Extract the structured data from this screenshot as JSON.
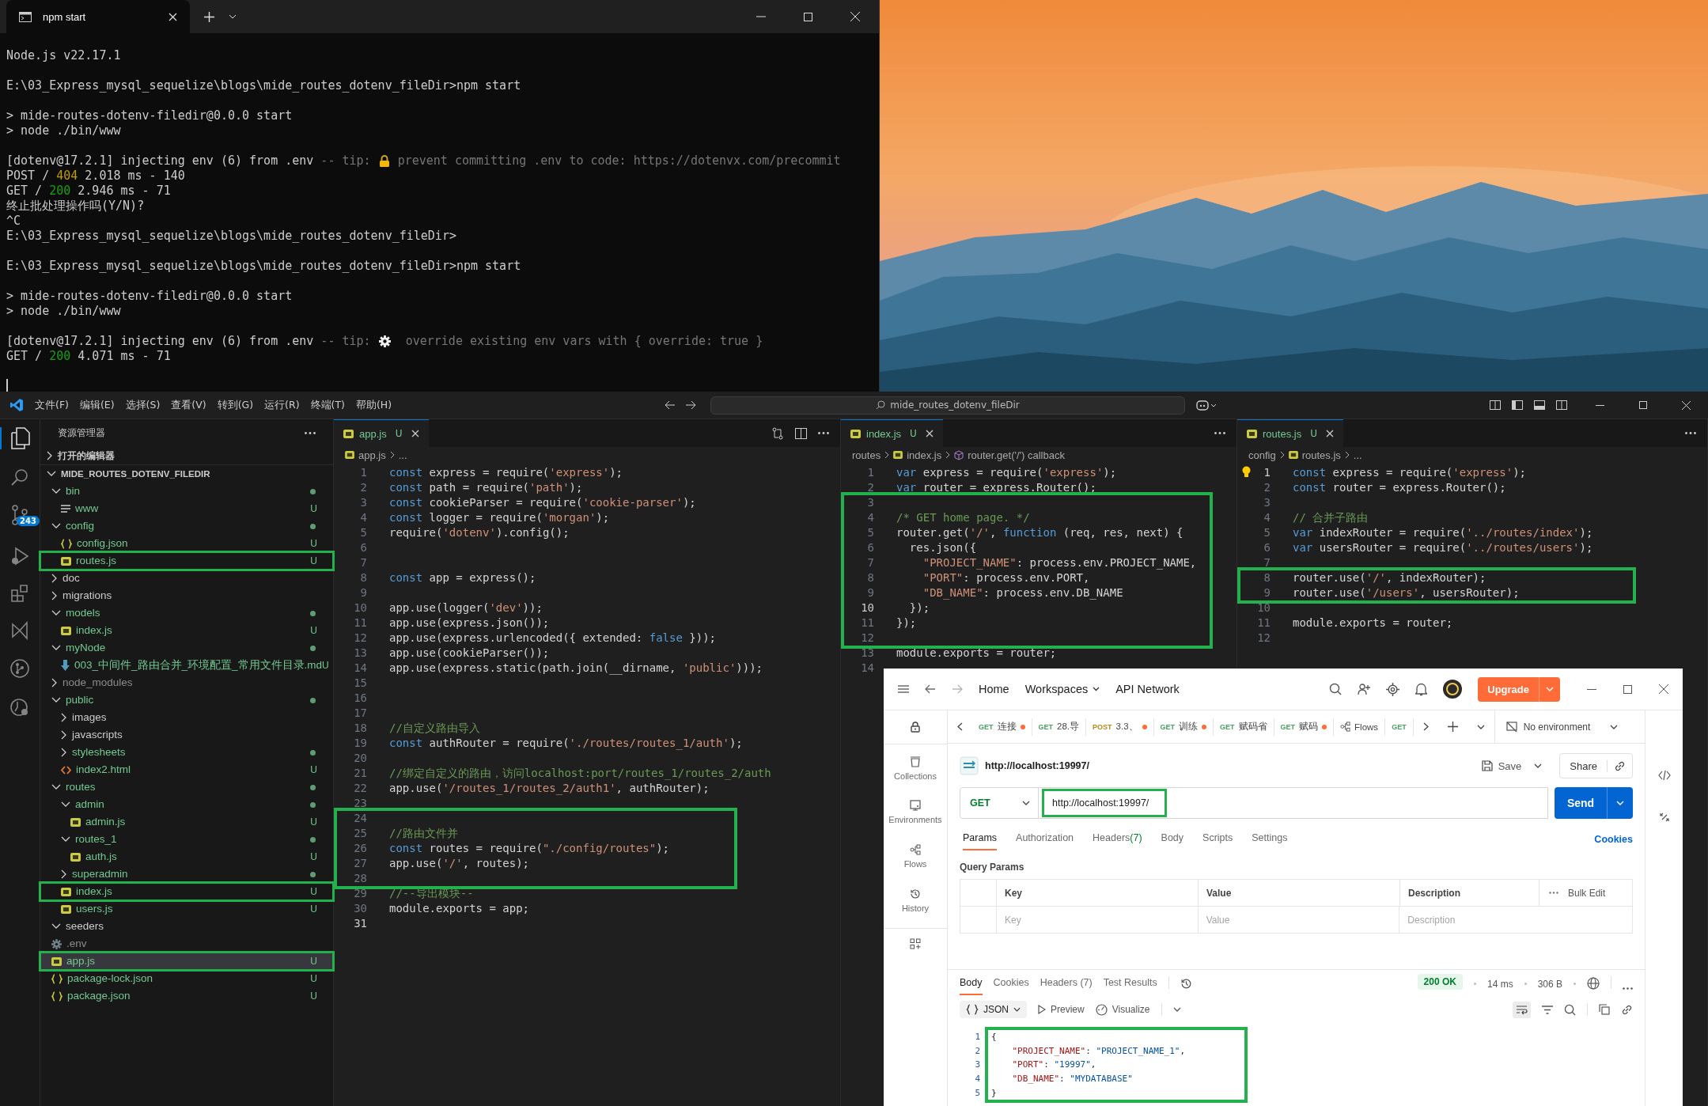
{
  "terminal": {
    "tab": "npm start",
    "blocks": [
      {
        "lines": [
          {
            "segments": [
              {
                "text": "Node.js v22.17.1",
                "kind": "txt"
              }
            ]
          }
        ]
      },
      {
        "lines": [
          {
            "segments": [
              {
                "text": "E:\\03_Express_mysql_sequelize\\blogs\\mide_routes_dotenv_fileDir>npm start",
                "kind": "txt"
              }
            ]
          }
        ]
      },
      {
        "lines": [
          {
            "segments": [
              {
                "text": "> mide-routes-dotenv-filedir@0.0.0 start",
                "kind": "txt"
              }
            ]
          },
          {
            "segments": [
              {
                "text": "> node ./bin/www",
                "kind": "txt"
              }
            ]
          }
        ]
      },
      {
        "lines": [
          {
            "segments": [
              {
                "text": "[dotenv@17.2.1] injecting env (6) from .env",
                "kind": "txt"
              },
              {
                "text": " -- tip: ",
                "kind": "dim"
              },
              {
                "kind": "lock"
              },
              {
                "text": " prevent committing .env to code: https://dotenvx.com/precommit",
                "kind": "dim"
              }
            ]
          },
          {
            "segments": [
              {
                "text": "POST / ",
                "kind": "txt"
              },
              {
                "text": "404",
                "kind": "warn"
              },
              {
                "text": " 2.018 ms - 140",
                "kind": "txt"
              }
            ]
          },
          {
            "segments": [
              {
                "text": "GET / ",
                "kind": "txt"
              },
              {
                "text": "200",
                "kind": "ok"
              },
              {
                "text": " 2.946 ms - 71",
                "kind": "txt"
              }
            ]
          },
          {
            "segments": [
              {
                "text": "终止批处理操作吗(Y/N)?",
                "kind": "txt"
              }
            ]
          },
          {
            "segments": [
              {
                "text": "^C",
                "kind": "txt"
              }
            ]
          },
          {
            "segments": [
              {
                "text": "E:\\03_Express_mysql_sequelize\\blogs\\mide_routes_dotenv_fileDir>",
                "kind": "txt"
              }
            ]
          }
        ]
      },
      {
        "lines": [
          {
            "segments": [
              {
                "text": "E:\\03_Express_mysql_sequelize\\blogs\\mide_routes_dotenv_fileDir>npm start",
                "kind": "txt"
              }
            ]
          }
        ]
      },
      {
        "lines": [
          {
            "segments": [
              {
                "text": "> mide-routes-dotenv-filedir@0.0.0 start",
                "kind": "txt"
              }
            ]
          },
          {
            "segments": [
              {
                "text": "> node ./bin/www",
                "kind": "txt"
              }
            ]
          }
        ]
      },
      {
        "lines": [
          {
            "segments": [
              {
                "text": "[dotenv@17.2.1] injecting env (6) from .env",
                "kind": "txt"
              },
              {
                "text": " -- tip: ",
                "kind": "dim"
              },
              {
                "kind": "gear"
              },
              {
                "text": "  override existing env vars with { override: true }",
                "kind": "dim"
              }
            ]
          },
          {
            "segments": [
              {
                "text": "GET / ",
                "kind": "txt"
              },
              {
                "text": "200",
                "kind": "ok"
              },
              {
                "text": " 4.071 ms - 71",
                "kind": "txt"
              }
            ]
          }
        ]
      }
    ]
  },
  "vscode": {
    "menu": [
      "文件(F)",
      "编辑(E)",
      "选择(S)",
      "查看(V)",
      "转到(G)",
      "运行(R)",
      "终端(T)",
      "帮助(H)"
    ],
    "search": "mide_routes_dotenv_fileDir",
    "scm_badge": "243",
    "explorer": {
      "title": "资源管理器",
      "open_editors": "打开的编辑器",
      "root": "MIDE_ROUTES_DOTENV_FILEDIR",
      "items": [
        {
          "name": "bin",
          "kind": "folder",
          "expanded": true,
          "dot": true,
          "color": "#73c991",
          "selected": false,
          "boxed": false,
          "children": [
            {
              "name": "www",
              "kind": "text",
              "status": "U",
              "color": "#73c991",
              "selected": false,
              "boxed": false
            }
          ]
        },
        {
          "name": "config",
          "kind": "folder",
          "expanded": true,
          "dot": true,
          "color": "#73c991",
          "selected": false,
          "boxed": false,
          "children": [
            {
              "name": "config.json",
              "kind": "json",
              "status": "U",
              "color": "#73c991",
              "selected": false,
              "boxed": false
            },
            {
              "name": "routes.js",
              "kind": "js",
              "status": "U",
              "color": "#73c991",
              "selected": false,
              "boxed": true
            }
          ]
        },
        {
          "name": "doc",
          "kind": "folder",
          "expanded": false,
          "dot": false,
          "color": "#cccccc",
          "selected": false,
          "boxed": false
        },
        {
          "name": "migrations",
          "kind": "folder",
          "expanded": false,
          "dot": false,
          "color": "#cccccc",
          "selected": false,
          "boxed": false
        },
        {
          "name": "models",
          "kind": "folder",
          "expanded": true,
          "dot": true,
          "color": "#73c991",
          "selected": false,
          "boxed": false,
          "children": [
            {
              "name": "index.js",
              "kind": "js",
              "status": "U",
              "color": "#73c991",
              "selected": false,
              "boxed": false
            }
          ]
        },
        {
          "name": "myNode",
          "kind": "folder",
          "expanded": true,
          "dot": true,
          "color": "#73c991",
          "selected": false,
          "boxed": false,
          "children": [
            {
              "name": "003_中间件_路由合并_环境配置_常用文件目录.md",
              "kind": "md",
              "status": "U",
              "color": "#73c991",
              "selected": false,
              "boxed": false
            }
          ]
        },
        {
          "name": "node_modules",
          "kind": "folder",
          "expanded": false,
          "dot": false,
          "color": "#8c8c8c",
          "selected": false,
          "boxed": false
        },
        {
          "name": "public",
          "kind": "folder",
          "expanded": true,
          "dot": true,
          "color": "#73c991",
          "selected": false,
          "boxed": false,
          "children": [
            {
              "name": "images",
              "kind": "folder",
              "expanded": false,
              "dot": false,
              "color": "#cccccc",
              "selected": false,
              "boxed": false
            },
            {
              "name": "javascripts",
              "kind": "folder",
              "expanded": false,
              "dot": false,
              "color": "#cccccc",
              "selected": false,
              "boxed": false
            },
            {
              "name": "stylesheets",
              "kind": "folder",
              "expanded": false,
              "dot": true,
              "color": "#73c991",
              "selected": false,
              "boxed": false
            },
            {
              "name": "index2.html",
              "kind": "html",
              "status": "U",
              "color": "#73c991",
              "selected": false,
              "boxed": false
            }
          ]
        },
        {
          "name": "routes",
          "kind": "folder",
          "expanded": true,
          "dot": true,
          "color": "#73c991",
          "selected": false,
          "boxed": false,
          "children": [
            {
              "name": "admin",
              "kind": "folder",
              "expanded": true,
              "dot": true,
              "color": "#73c991",
              "selected": false,
              "boxed": false,
              "children": [
                {
                  "name": "admin.js",
                  "kind": "js",
                  "status": "U",
                  "color": "#73c991",
                  "selected": false,
                  "boxed": false
                }
              ]
            },
            {
              "name": "routes_1",
              "kind": "folder",
              "expanded": true,
              "dot": true,
              "color": "#73c991",
              "selected": false,
              "boxed": false,
              "children": [
                {
                  "name": "auth.js",
                  "kind": "js",
                  "status": "U",
                  "color": "#73c991",
                  "selected": false,
                  "boxed": false
                }
              ]
            },
            {
              "name": "superadmin",
              "kind": "folder",
              "expanded": false,
              "dot": true,
              "color": "#73c991",
              "selected": false,
              "boxed": false
            },
            {
              "name": "index.js",
              "kind": "js",
              "status": "U",
              "color": "#73c991",
              "selected": false,
              "boxed": true
            },
            {
              "name": "users.js",
              "kind": "js",
              "status": "U",
              "color": "#73c991",
              "selected": false,
              "boxed": false
            }
          ]
        },
        {
          "name": "seeders",
          "kind": "folder",
          "expanded": true,
          "dot": false,
          "color": "#cccccc",
          "selected": false,
          "boxed": false
        },
        {
          "name": ".env",
          "kind": "env",
          "color": "#8c8c8c",
          "selected": false,
          "boxed": false
        },
        {
          "name": "app.js",
          "kind": "js",
          "status": "U",
          "color": "#73c991",
          "selected": true,
          "boxed": true
        },
        {
          "name": "package-lock.json",
          "kind": "json",
          "status": "U",
          "color": "#73c991",
          "selected": false,
          "boxed": false
        },
        {
          "name": "package.json",
          "kind": "json",
          "status": "U",
          "color": "#73c991",
          "selected": false,
          "boxed": false
        }
      ]
    },
    "editors": [
      {
        "tab": {
          "name": "app.js",
          "status": "U"
        },
        "breadcrumb": [
          {
            "text": "app.js",
            "kind": "js"
          },
          {
            "text": "...",
            "kind": "more"
          }
        ],
        "blocks": [
          {
            "boxed": false,
            "lines": [
              {
                "num": "1",
                "tokens": [
                  {
                    "text": "const",
                    "kind": "kw"
                  },
                  {
                    "text": " express = require(",
                    "kind": "txt"
                  },
                  {
                    "text": "'express'",
                    "kind": "str"
                  },
                  {
                    "text": ");",
                    "kind": "txt"
                  }
                ]
              },
              {
                "num": "2",
                "tokens": [
                  {
                    "text": "const",
                    "kind": "kw"
                  },
                  {
                    "text": " path = require(",
                    "kind": "txt"
                  },
                  {
                    "text": "'path'",
                    "kind": "str"
                  },
                  {
                    "text": ");",
                    "kind": "txt"
                  }
                ]
              },
              {
                "num": "3",
                "tokens": [
                  {
                    "text": "const",
                    "kind": "kw"
                  },
                  {
                    "text": " cookieParser = require(",
                    "kind": "txt"
                  },
                  {
                    "text": "'cookie-parser'",
                    "kind": "str"
                  },
                  {
                    "text": ");",
                    "kind": "txt"
                  }
                ]
              },
              {
                "num": "4",
                "tokens": [
                  {
                    "text": "const",
                    "kind": "kw"
                  },
                  {
                    "text": " logger = require(",
                    "kind": "txt"
                  },
                  {
                    "text": "'morgan'",
                    "kind": "str"
                  },
                  {
                    "text": ");",
                    "kind": "txt"
                  }
                ]
              },
              {
                "num": "5",
                "tokens": [
                  {
                    "text": "require(",
                    "kind": "txt"
                  },
                  {
                    "text": "'dotenv'",
                    "kind": "str"
                  },
                  {
                    "text": ").config();",
                    "kind": "txt"
                  }
                ]
              },
              {
                "num": "6"
              },
              {
                "num": "7"
              },
              {
                "num": "8",
                "tokens": [
                  {
                    "text": "const",
                    "kind": "kw"
                  },
                  {
                    "text": " app = express();",
                    "kind": "txt"
                  }
                ]
              },
              {
                "num": "9"
              },
              {
                "num": "10",
                "tokens": [
                  {
                    "text": "app.use(logger(",
                    "kind": "txt"
                  },
                  {
                    "text": "'dev'",
                    "kind": "str"
                  },
                  {
                    "text": "));",
                    "kind": "txt"
                  }
                ]
              },
              {
                "num": "11",
                "tokens": [
                  {
                    "text": "app.use(express.json());",
                    "kind": "txt"
                  }
                ]
              },
              {
                "num": "12",
                "tokens": [
                  {
                    "text": "app.use(express.urlencoded({ extended: ",
                    "kind": "txt"
                  },
                  {
                    "text": "false",
                    "kind": "kw"
                  },
                  {
                    "text": " }));",
                    "kind": "txt"
                  }
                ]
              },
              {
                "num": "13",
                "tokens": [
                  {
                    "text": "app.use(cookieParser());",
                    "kind": "txt"
                  }
                ]
              },
              {
                "num": "14",
                "tokens": [
                  {
                    "text": "app.use(express.static(path.join(__dirname, ",
                    "kind": "txt"
                  },
                  {
                    "text": "'public'",
                    "kind": "str"
                  },
                  {
                    "text": ")));",
                    "kind": "txt"
                  }
                ]
              },
              {
                "num": "15"
              },
              {
                "num": "16"
              },
              {
                "num": "17"
              },
              {
                "num": "18",
                "tokens": [
                  {
                    "text": "//自定义路由导入",
                    "kind": "com"
                  }
                ]
              },
              {
                "num": "19",
                "tokens": [
                  {
                    "text": "const",
                    "kind": "kw"
                  },
                  {
                    "text": " authRouter = require(",
                    "kind": "txt"
                  },
                  {
                    "text": "'./routes/routes_1/auth'",
                    "kind": "str"
                  },
                  {
                    "text": ");",
                    "kind": "txt"
                  }
                ]
              },
              {
                "num": "20"
              },
              {
                "num": "21",
                "tokens": [
                  {
                    "text": "//绑定自定义的路由，访问localhost:port/routes_1/routes_2/auth",
                    "kind": "com"
                  }
                ]
              },
              {
                "num": "22",
                "tokens": [
                  {
                    "text": "app.use(",
                    "kind": "txt"
                  },
                  {
                    "text": "'/routes_1/routes_2/auth1'",
                    "kind": "str"
                  },
                  {
                    "text": ", authRouter);",
                    "kind": "txt"
                  }
                ]
              },
              {
                "num": "23"
              }
            ]
          },
          {
            "boxed": true,
            "lines": [
              {
                "num": "24"
              },
              {
                "num": "25",
                "tokens": [
                  {
                    "text": "//路由文件并",
                    "kind": "com"
                  }
                ]
              },
              {
                "num": "26",
                "tokens": [
                  {
                    "text": "const",
                    "kind": "kw"
                  },
                  {
                    "text": " routes = require(",
                    "kind": "txt"
                  },
                  {
                    "text": "\"./config/routes\"",
                    "kind": "str"
                  },
                  {
                    "text": ");",
                    "kind": "txt"
                  }
                ]
              },
              {
                "num": "27",
                "tokens": [
                  {
                    "text": "app.use(",
                    "kind": "txt"
                  },
                  {
                    "text": "'/'",
                    "kind": "str"
                  },
                  {
                    "text": ", routes);",
                    "kind": "txt"
                  }
                ]
              },
              {
                "num": "28"
              }
            ]
          },
          {
            "boxed": false,
            "lines": [
              {
                "num": "29",
                "tokens": [
                  {
                    "text": "//--导出模块--",
                    "kind": "com"
                  }
                ]
              },
              {
                "num": "30",
                "tokens": [
                  {
                    "text": "module.exports = app;",
                    "kind": "txt"
                  }
                ]
              },
              {
                "num": "31",
                "current": true
              }
            ]
          }
        ]
      },
      {
        "tab": {
          "name": "index.js",
          "status": "U"
        },
        "breadcrumb": [
          {
            "text": "routes",
            "kind": "folder"
          },
          {
            "text": "index.js",
            "kind": "js"
          },
          {
            "text": "router.get('/') callback",
            "kind": "symbol"
          }
        ],
        "blocks": [
          {
            "boxed": false,
            "lines": [
              {
                "num": "1",
                "tokens": [
                  {
                    "text": "var",
                    "kind": "kw"
                  },
                  {
                    "text": " express = require(",
                    "kind": "txt"
                  },
                  {
                    "text": "'express'",
                    "kind": "str"
                  },
                  {
                    "text": ");",
                    "kind": "txt"
                  }
                ]
              },
              {
                "num": "2",
                "tokens": [
                  {
                    "text": "var",
                    "kind": "kw"
                  },
                  {
                    "text": " router = express.Router();",
                    "kind": "txt"
                  }
                ]
              }
            ]
          },
          {
            "boxed": true,
            "lines": [
              {
                "num": "3"
              },
              {
                "num": "4",
                "tokens": [
                  {
                    "text": "/* GET home page. */",
                    "kind": "com"
                  }
                ]
              },
              {
                "num": "5",
                "tokens": [
                  {
                    "text": "router.get(",
                    "kind": "txt"
                  },
                  {
                    "text": "'/'",
                    "kind": "str"
                  },
                  {
                    "text": ", ",
                    "kind": "txt"
                  },
                  {
                    "text": "function",
                    "kind": "kw"
                  },
                  {
                    "text": " (req, res, next) {",
                    "kind": "txt"
                  }
                ]
              },
              {
                "num": "6",
                "tokens": [
                  {
                    "text": "  res.json({",
                    "kind": "txt"
                  }
                ]
              },
              {
                "num": "7",
                "tokens": [
                  {
                    "text": "    \"PROJECT_NAME\"",
                    "kind": "str"
                  },
                  {
                    "text": ": process.env.PROJECT_NAME,",
                    "kind": "txt"
                  }
                ]
              },
              {
                "num": "8",
                "tokens": [
                  {
                    "text": "    \"PORT\"",
                    "kind": "str"
                  },
                  {
                    "text": ": process.env.PORT,",
                    "kind": "txt"
                  }
                ]
              },
              {
                "num": "9",
                "tokens": [
                  {
                    "text": "    \"DB_NAME\"",
                    "kind": "str"
                  },
                  {
                    "text": ": process.env.DB_NAME",
                    "kind": "txt"
                  }
                ]
              },
              {
                "num": "10",
                "current": true,
                "tokens": [
                  {
                    "text": "  });",
                    "kind": "txt"
                  }
                ]
              },
              {
                "num": "11",
                "tokens": [
                  {
                    "text": "});",
                    "kind": "txt"
                  }
                ]
              },
              {
                "num": "12"
              }
            ]
          },
          {
            "boxed": false,
            "lines": [
              {
                "num": "13",
                "tokens": [
                  {
                    "text": "module.exports = router;",
                    "kind": "txt"
                  }
                ]
              },
              {
                "num": "14"
              }
            ]
          }
        ]
      },
      {
        "tab": {
          "name": "routes.js",
          "status": "U"
        },
        "breadcrumb": [
          {
            "text": "config",
            "kind": "folder"
          },
          {
            "text": "routes.js",
            "kind": "js"
          },
          {
            "text": "...",
            "kind": "more"
          }
        ],
        "blocks": [
          {
            "boxed": false,
            "lines": [
              {
                "num": "1",
                "current": true,
                "tokens": [
                  {
                    "text": "const",
                    "kind": "kw"
                  },
                  {
                    "text": " express = require(",
                    "kind": "txt"
                  },
                  {
                    "text": "'express'",
                    "kind": "str"
                  },
                  {
                    "text": ");",
                    "kind": "txt"
                  }
                ]
              },
              {
                "num": "2",
                "tokens": [
                  {
                    "text": "const",
                    "kind": "kw"
                  },
                  {
                    "text": " router = express.Router();",
                    "kind": "txt"
                  }
                ]
              },
              {
                "num": "3"
              },
              {
                "num": "4",
                "tokens": [
                  {
                    "text": "// 合并子路由",
                    "kind": "com"
                  }
                ]
              },
              {
                "num": "5",
                "tokens": [
                  {
                    "text": "var",
                    "kind": "kw"
                  },
                  {
                    "text": " indexRouter = require(",
                    "kind": "txt"
                  },
                  {
                    "text": "'../routes/index'",
                    "kind": "str"
                  },
                  {
                    "text": ");",
                    "kind": "txt"
                  }
                ]
              },
              {
                "num": "6",
                "tokens": [
                  {
                    "text": "var",
                    "kind": "kw"
                  },
                  {
                    "text": " usersRouter = require(",
                    "kind": "txt"
                  },
                  {
                    "text": "'../routes/users'",
                    "kind": "str"
                  },
                  {
                    "text": ");",
                    "kind": "txt"
                  }
                ]
              },
              {
                "num": "7"
              }
            ]
          },
          {
            "boxed": true,
            "lines": [
              {
                "num": "8",
                "tokens": [
                  {
                    "text": "router.use(",
                    "kind": "txt"
                  },
                  {
                    "text": "'/'",
                    "kind": "str"
                  },
                  {
                    "text": ", indexRouter);",
                    "kind": "txt"
                  }
                ]
              },
              {
                "num": "9",
                "tokens": [
                  {
                    "text": "router.use(",
                    "kind": "txt"
                  },
                  {
                    "text": "'/users'",
                    "kind": "str"
                  },
                  {
                    "text": ", usersRouter);",
                    "kind": "txt"
                  }
                ]
              }
            ]
          },
          {
            "boxed": false,
            "lines": [
              {
                "num": "10"
              },
              {
                "num": "11",
                "tokens": [
                  {
                    "text": "module.exports = router;",
                    "kind": "txt"
                  }
                ]
              },
              {
                "num": "12"
              }
            ]
          }
        ]
      }
    ]
  },
  "postman": {
    "nav": [
      {
        "label": "Home",
        "kind": "link"
      },
      {
        "label": "Workspaces",
        "kind": "menu"
      },
      {
        "label": "API Network",
        "kind": "link"
      }
    ],
    "upgrade": "Upgrade",
    "tabs": [
      {
        "kind": "request",
        "method": "GET",
        "color": "#4a9f62",
        "name": "连接",
        "dirty": true
      },
      {
        "kind": "request",
        "method": "GET",
        "color": "#4a9f62",
        "name": "28.导",
        "dirty": false
      },
      {
        "kind": "request",
        "method": "POST",
        "color": "#b5881c",
        "name": "3.3、",
        "dirty": true
      },
      {
        "kind": "request",
        "method": "GET",
        "color": "#4a9f62",
        "name": "训练",
        "dirty": true
      },
      {
        "kind": "request",
        "method": "GET",
        "color": "#4a9f62",
        "name": "赋码省",
        "dirty": false
      },
      {
        "kind": "request",
        "method": "GET",
        "color": "#4a9f62",
        "name": "赋码",
        "dirty": true
      },
      {
        "kind": "flows",
        "name": "Flows",
        "dirty": false
      },
      {
        "kind": "request",
        "method": "GET",
        "color": "#4a9f62",
        "dirty": false
      }
    ],
    "environment": "No environment",
    "sidebar": [
      {
        "label": "Collections",
        "kind": "collections"
      },
      {
        "label": "Environments",
        "kind": "environments"
      },
      {
        "label": "Flows",
        "kind": "flows"
      },
      {
        "label": "History",
        "kind": "history"
      }
    ],
    "request": {
      "title": "http://localhost:19997/",
      "save": "Save",
      "share": "Share",
      "method": "GET",
      "url": "http://localhost:19997/",
      "url_boxed": true,
      "send": "Send",
      "tabs": [
        {
          "label": "Params",
          "selected": true
        },
        {
          "label": "Authorization",
          "selected": false
        },
        {
          "label": "Headers",
          "count": "(7)",
          "selected": false
        },
        {
          "label": "Body",
          "selected": false
        },
        {
          "label": "Scripts",
          "selected": false
        },
        {
          "label": "Settings",
          "selected": false
        }
      ],
      "cookies": "Cookies",
      "params_title": "Query Params",
      "columns": [
        "Key",
        "Value",
        "Description"
      ],
      "bulk_edit": "Bulk Edit",
      "placeholders": [
        "Key",
        "Value",
        "Description"
      ]
    },
    "response": {
      "tabs": [
        {
          "label": "Body",
          "selected": true
        },
        {
          "label": "Cookies",
          "selected": false
        },
        {
          "label": "Headers (7)",
          "selected": false
        },
        {
          "label": "Test Results",
          "selected": false
        }
      ],
      "status": "200 OK",
      "time": "14 ms",
      "size": "306 B",
      "format": "JSON",
      "preview": "Preview",
      "visualize": "Visualize",
      "boxed": true,
      "lines": [
        {
          "num": "1",
          "tokens": [
            {
              "text": "{",
              "kind": "txt"
            }
          ]
        },
        {
          "num": "2",
          "tokens": [
            {
              "text": "    \"PROJECT_NAME\"",
              "kind": "key"
            },
            {
              "text": ": ",
              "kind": "txt"
            },
            {
              "text": "\"PROJECT_NAME_1\"",
              "kind": "val"
            },
            {
              "text": ",",
              "kind": "txt"
            }
          ]
        },
        {
          "num": "3",
          "tokens": [
            {
              "text": "    \"PORT\"",
              "kind": "key"
            },
            {
              "text": ": ",
              "kind": "txt"
            },
            {
              "text": "\"19997\"",
              "kind": "val"
            },
            {
              "text": ",",
              "kind": "txt"
            }
          ]
        },
        {
          "num": "4",
          "tokens": [
            {
              "text": "    \"DB_NAME\"",
              "kind": "key"
            },
            {
              "text": ": ",
              "kind": "txt"
            },
            {
              "text": "\"MYDATABASE\"",
              "kind": "val"
            }
          ]
        },
        {
          "num": "5",
          "tokens": [
            {
              "text": "}",
              "kind": "txt"
            }
          ]
        }
      ]
    }
  }
}
